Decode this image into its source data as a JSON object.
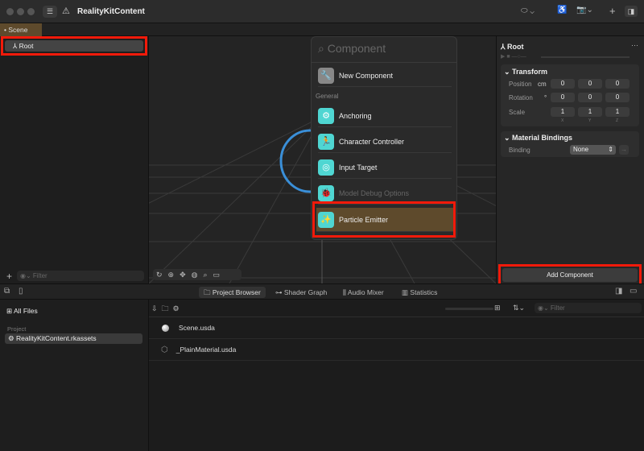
{
  "window": {
    "title": "RealityKitContent"
  },
  "tabs": [
    {
      "label": "Scene"
    }
  ],
  "hierarchy": {
    "root_label": "Root",
    "filter_placeholder": "Filter"
  },
  "popup": {
    "search_placeholder": "Component",
    "new_component": "New Component",
    "section": "General",
    "items": [
      {
        "label": "Anchoring",
        "icon": "gear-icon",
        "disabled": false
      },
      {
        "label": "Character Controller",
        "icon": "running-figure-icon",
        "disabled": false
      },
      {
        "label": "Input Target",
        "icon": "target-icon",
        "disabled": false
      },
      {
        "label": "Model Debug Options",
        "icon": "bug-icon",
        "disabled": true
      },
      {
        "label": "Particle Emitter",
        "icon": "sparkles-icon",
        "disabled": false,
        "selected": true
      }
    ]
  },
  "inspector": {
    "title": "Root",
    "transform": {
      "title": "Transform",
      "position_label": "Position",
      "position_unit": "cm",
      "position": [
        "0",
        "0",
        "0"
      ],
      "rotation_label": "Rotation",
      "rotation_unit": "°",
      "rotation": [
        "0",
        "0",
        "0"
      ],
      "scale_label": "Scale",
      "scale": [
        "1",
        "1",
        "1"
      ],
      "axes": [
        "X",
        "Y",
        "Z"
      ]
    },
    "material": {
      "title": "Material Bindings",
      "binding_label": "Binding",
      "binding_value": "None"
    },
    "add_component": "Add Component"
  },
  "bottom_tabs": [
    {
      "label": "Project Browser",
      "selected": true
    },
    {
      "label": "Shader Graph"
    },
    {
      "label": "Audio Mixer"
    },
    {
      "label": "Statistics"
    }
  ],
  "browser": {
    "all_files": "All Files",
    "project_label": "Project",
    "project_item": "RealityKitContent.rkassets",
    "filter_placeholder": "Filter",
    "files": [
      {
        "name": "Scene.usda"
      },
      {
        "name": "_PlainMaterial.usda"
      }
    ]
  },
  "colors": {
    "accent_red": "#f21a0a",
    "teal": "#4fd6d2",
    "selected_brown": "#5e4a2c"
  }
}
